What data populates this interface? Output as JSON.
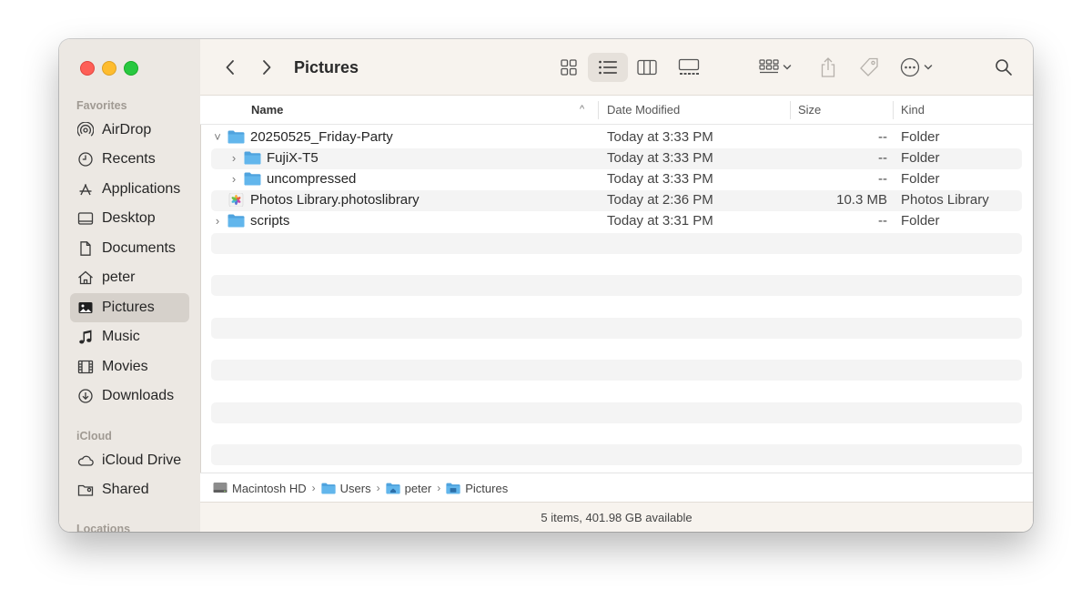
{
  "window": {
    "title": "Pictures"
  },
  "sidebar": {
    "sections": [
      "Favorites",
      "iCloud",
      "Locations"
    ],
    "favorites": [
      {
        "label": "AirDrop",
        "icon": "airdrop-icon"
      },
      {
        "label": "Recents",
        "icon": "clock-icon"
      },
      {
        "label": "Applications",
        "icon": "applications-icon"
      },
      {
        "label": "Desktop",
        "icon": "desktop-icon"
      },
      {
        "label": "Documents",
        "icon": "document-icon"
      },
      {
        "label": "peter",
        "icon": "home-icon"
      },
      {
        "label": "Pictures",
        "icon": "photo-icon",
        "selected": true
      },
      {
        "label": "Music",
        "icon": "music-note-icon"
      },
      {
        "label": "Movies",
        "icon": "film-icon"
      },
      {
        "label": "Downloads",
        "icon": "download-icon"
      }
    ],
    "icloud": [
      {
        "label": "iCloud Drive",
        "icon": "cloud-icon"
      },
      {
        "label": "Shared",
        "icon": "shared-folder-icon"
      }
    ]
  },
  "columns": {
    "name": "Name",
    "date": "Date Modified",
    "size": "Size",
    "kind": "Kind",
    "sort_indicator": "^"
  },
  "rows": [
    {
      "name": "20250525_Friday-Party",
      "date": "Today at 3:33 PM",
      "size": "--",
      "kind": "Folder",
      "disclosure": "˅"
    },
    {
      "name": "FujiX-T5",
      "date": "Today at 3:33 PM",
      "size": "--",
      "kind": "Folder",
      "disclosure": "›"
    },
    {
      "name": "uncompressed",
      "date": "Today at 3:33 PM",
      "size": "--",
      "kind": "Folder",
      "disclosure": "›"
    },
    {
      "name": "Photos Library.photoslibrary",
      "date": "Today at 2:36 PM",
      "size": "10.3 MB",
      "kind": "Photos Library",
      "disclosure": ""
    },
    {
      "name": "scripts",
      "date": "Today at 3:31 PM",
      "size": "--",
      "kind": "Folder",
      "disclosure": "›"
    }
  ],
  "pathbar": {
    "items": [
      "Macintosh HD",
      "Users",
      "peter",
      "Pictures"
    ],
    "separator": "›"
  },
  "status": "5 items, 401.98 GB available",
  "colors": {
    "folder": "#4fa3de",
    "accent": "#1d7cf2",
    "sidebar_bg": "#ece8e3",
    "selected_bg": "#d6d1cb"
  }
}
